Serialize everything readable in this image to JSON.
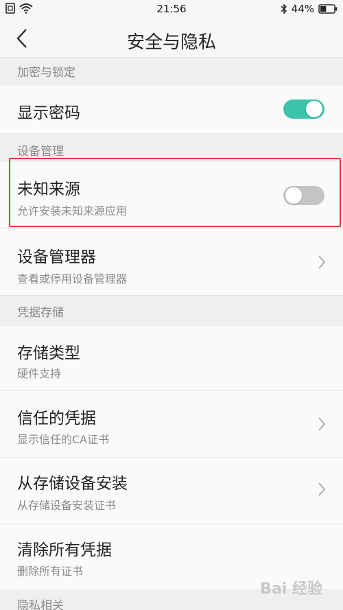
{
  "status_bar": {
    "time": "21:56",
    "battery_percent": "44%",
    "battery_level": 0.44,
    "icons": [
      "sim-icon",
      "wifi-icon",
      "bluetooth-icon",
      "battery-icon"
    ]
  },
  "header": {
    "title": "安全与隐私",
    "back_icon": "chevron-left-icon"
  },
  "sections": [
    {
      "header": "加密与锁定",
      "items": [
        {
          "title": "显示密码",
          "subtitle": "",
          "control": "toggle",
          "toggle_on": true
        }
      ]
    },
    {
      "header": "设备管理",
      "items": [
        {
          "title": "未知来源",
          "subtitle": "允许安装未知来源应用",
          "control": "toggle",
          "toggle_on": false,
          "highlighted": true
        },
        {
          "title": "设备管理器",
          "subtitle": "查看或停用设备管理器",
          "control": "chevron"
        }
      ]
    },
    {
      "header": "凭据存储",
      "items": [
        {
          "title": "存储类型",
          "subtitle": "硬件支持",
          "control": "none"
        },
        {
          "title": "信任的凭据",
          "subtitle": "显示信任的CA证书",
          "control": "chevron"
        },
        {
          "title": "从存储设备安装",
          "subtitle": "从存储设备安装证书",
          "control": "chevron"
        },
        {
          "title": "清除所有凭据",
          "subtitle": "删除所有证书",
          "control": "none"
        }
      ]
    },
    {
      "header": "隐私相关",
      "items": []
    }
  ],
  "watermark": "Bai 经验",
  "colors": {
    "toggle_on": "#3cc3aa",
    "toggle_off": "#c4c4c4",
    "highlight": "#e53935"
  }
}
